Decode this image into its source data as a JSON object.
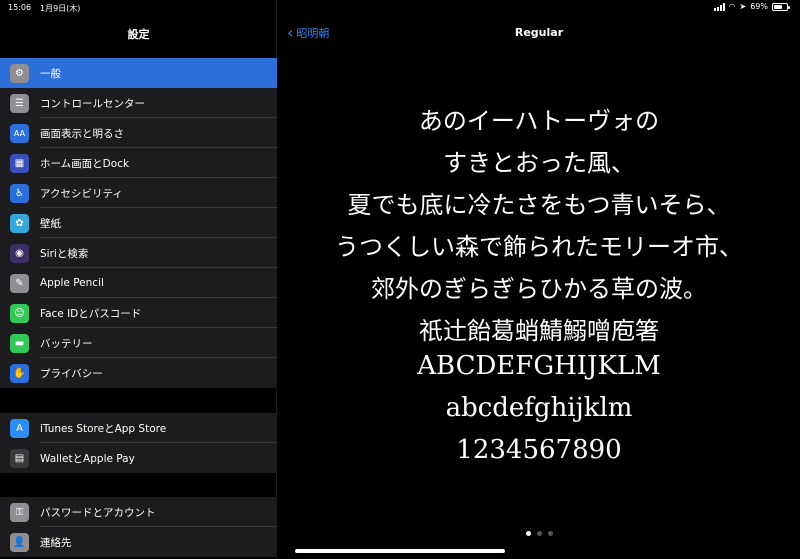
{
  "status": {
    "time": "15:06",
    "date": "1月9日(木)",
    "battery": "69%",
    "battery_level": 0.69
  },
  "sidebar": {
    "title": "設定",
    "groups": [
      [
        {
          "label": "一般",
          "icon": "gear-icon",
          "color": "#8e8e93",
          "glyph": "⚙",
          "selected": true
        },
        {
          "label": "コントロールセンター",
          "icon": "switches-icon",
          "color": "#8e8e93",
          "glyph": "☰"
        },
        {
          "label": "画面表示と明るさ",
          "icon": "text-size-icon",
          "color": "#2c6fd9",
          "glyph": "AA"
        },
        {
          "label": "ホーム画面とDock",
          "icon": "home-grid-icon",
          "color": "#3a4fb8",
          "glyph": "▦"
        },
        {
          "label": "アクセシビリティ",
          "icon": "accessibility-icon",
          "color": "#2c6fd9",
          "glyph": "♿"
        },
        {
          "label": "壁紙",
          "icon": "wallpaper-flower-icon",
          "color": "#35a6d8",
          "glyph": "✿"
        },
        {
          "label": "Siriと検索",
          "icon": "siri-icon",
          "color": "#3b2f63",
          "glyph": "◉"
        },
        {
          "label": "Apple Pencil",
          "icon": "pencil-icon",
          "color": "#8e8e93",
          "glyph": "✎"
        },
        {
          "label": "Face IDとパスコード",
          "icon": "face-id-icon",
          "color": "#34c759",
          "glyph": "☺"
        },
        {
          "label": "バッテリー",
          "icon": "battery-icon",
          "color": "#34c759",
          "glyph": "▬"
        },
        {
          "label": "プライバシー",
          "icon": "hand-icon",
          "color": "#2c6fd9",
          "glyph": "✋"
        }
      ],
      [
        {
          "label": "iTunes StoreとApp Store",
          "icon": "app-store-icon",
          "color": "#2c8ef5",
          "glyph": "A"
        },
        {
          "label": "WalletとApple Pay",
          "icon": "wallet-icon",
          "color": "#3a3a3c",
          "glyph": "▤"
        }
      ],
      [
        {
          "label": "パスワードとアカウント",
          "icon": "key-icon",
          "color": "#8e8e93",
          "glyph": "⚿"
        },
        {
          "label": "連絡先",
          "icon": "contacts-icon",
          "color": "#8e8e93",
          "glyph": "👤"
        }
      ]
    ]
  },
  "main": {
    "back_label": "昭明朝",
    "title": "Regular",
    "sample_lines": [
      "あのイーハトーヴォの",
      "すきとおった風、",
      "夏でも底に冷たさをもつ青いそら、",
      "うつくしい森で飾られたモリーオ市、",
      "郊外のぎらぎらひかる草の波。",
      "祇辻飴葛蛸鯖鰯噌庖箸",
      "ABCDEFGHIJKLM",
      "abcdefghijklm",
      "1234567890"
    ],
    "page_count": 3,
    "current_page": 1
  },
  "colors": {
    "accent": "#3a82f7",
    "selection": "#2c6fd9",
    "group_bg": "#1c1c1e"
  }
}
